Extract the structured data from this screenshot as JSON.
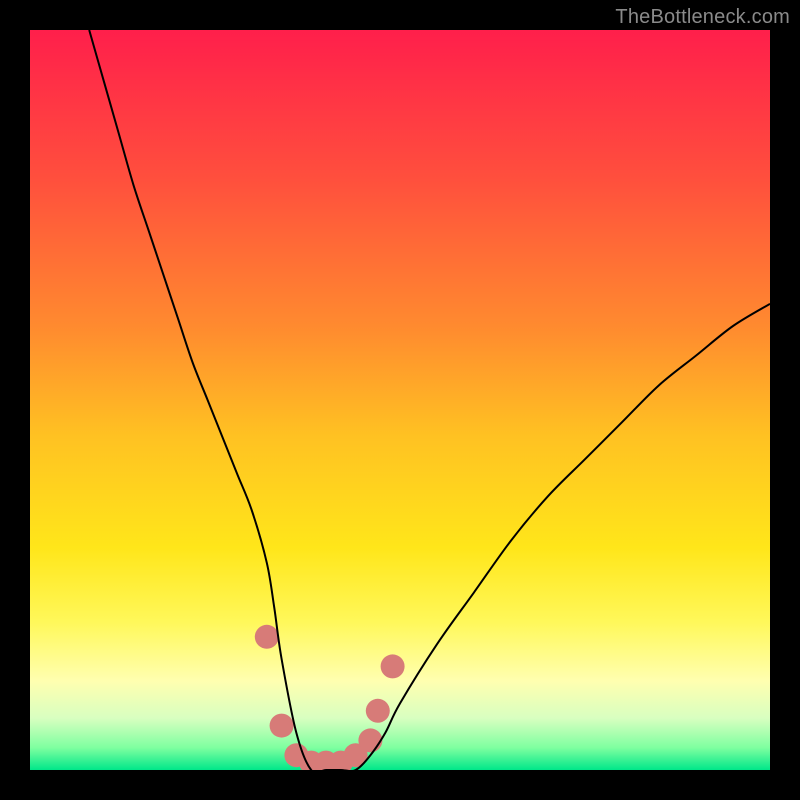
{
  "watermark": "TheBottleneck.com",
  "chart_data": {
    "type": "line",
    "title": "",
    "xlabel": "",
    "ylabel": "",
    "xlim": [
      0,
      100
    ],
    "ylim": [
      0,
      100
    ],
    "grid": false,
    "legend": false,
    "background_gradient": {
      "stops": [
        {
          "offset": 0.0,
          "color": "#ff1f4b"
        },
        {
          "offset": 0.2,
          "color": "#ff4f3d"
        },
        {
          "offset": 0.4,
          "color": "#ff8a2f"
        },
        {
          "offset": 0.55,
          "color": "#ffc222"
        },
        {
          "offset": 0.7,
          "color": "#ffe61a"
        },
        {
          "offset": 0.8,
          "color": "#fff85a"
        },
        {
          "offset": 0.88,
          "color": "#ffffb0"
        },
        {
          "offset": 0.93,
          "color": "#d8ffc0"
        },
        {
          "offset": 0.97,
          "color": "#7effa0"
        },
        {
          "offset": 1.0,
          "color": "#00e78a"
        }
      ]
    },
    "series": [
      {
        "name": "bottleneck-curve",
        "color": "#000000",
        "stroke_width": 2,
        "x": [
          8,
          10,
          12,
          14,
          16,
          18,
          20,
          22,
          24,
          26,
          28,
          30,
          32,
          33,
          34,
          36,
          38,
          40,
          42,
          44,
          46,
          48,
          50,
          55,
          60,
          65,
          70,
          75,
          80,
          85,
          90,
          95,
          100
        ],
        "y": [
          100,
          93,
          86,
          79,
          73,
          67,
          61,
          55,
          50,
          45,
          40,
          35,
          28,
          22,
          15,
          5,
          0,
          0,
          0,
          0,
          2,
          5,
          9,
          17,
          24,
          31,
          37,
          42,
          47,
          52,
          56,
          60,
          63
        ]
      }
    ],
    "markers": {
      "name": "highlight-dots",
      "color": "#d77b78",
      "radius_px": 12,
      "points": [
        {
          "x": 32,
          "y": 18
        },
        {
          "x": 34,
          "y": 6
        },
        {
          "x": 36,
          "y": 2
        },
        {
          "x": 38,
          "y": 1
        },
        {
          "x": 40,
          "y": 1
        },
        {
          "x": 42,
          "y": 1
        },
        {
          "x": 44,
          "y": 2
        },
        {
          "x": 46,
          "y": 4
        },
        {
          "x": 47,
          "y": 8
        },
        {
          "x": 49,
          "y": 14
        }
      ]
    }
  }
}
